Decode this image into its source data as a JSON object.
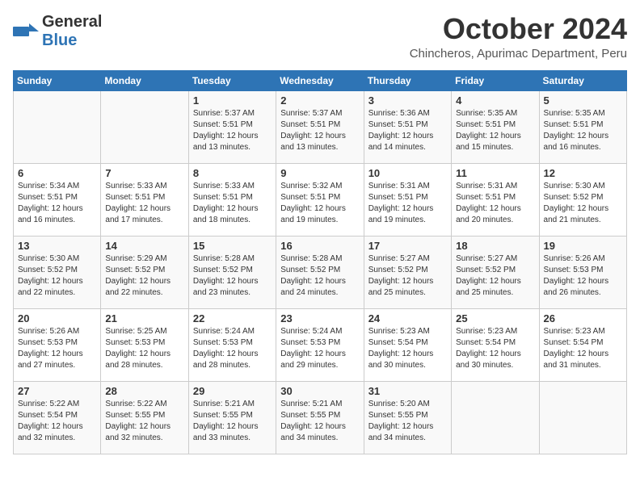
{
  "logo": {
    "general": "General",
    "blue": "Blue"
  },
  "title": "October 2024",
  "subtitle": "Chincheros, Apurimac Department, Peru",
  "days_header": [
    "Sunday",
    "Monday",
    "Tuesday",
    "Wednesday",
    "Thursday",
    "Friday",
    "Saturday"
  ],
  "weeks": [
    [
      {
        "day": "",
        "sunrise": "",
        "sunset": "",
        "daylight": ""
      },
      {
        "day": "",
        "sunrise": "",
        "sunset": "",
        "daylight": ""
      },
      {
        "day": "1",
        "sunrise": "Sunrise: 5:37 AM",
        "sunset": "Sunset: 5:51 PM",
        "daylight": "Daylight: 12 hours and 13 minutes."
      },
      {
        "day": "2",
        "sunrise": "Sunrise: 5:37 AM",
        "sunset": "Sunset: 5:51 PM",
        "daylight": "Daylight: 12 hours and 13 minutes."
      },
      {
        "day": "3",
        "sunrise": "Sunrise: 5:36 AM",
        "sunset": "Sunset: 5:51 PM",
        "daylight": "Daylight: 12 hours and 14 minutes."
      },
      {
        "day": "4",
        "sunrise": "Sunrise: 5:35 AM",
        "sunset": "Sunset: 5:51 PM",
        "daylight": "Daylight: 12 hours and 15 minutes."
      },
      {
        "day": "5",
        "sunrise": "Sunrise: 5:35 AM",
        "sunset": "Sunset: 5:51 PM",
        "daylight": "Daylight: 12 hours and 16 minutes."
      }
    ],
    [
      {
        "day": "6",
        "sunrise": "Sunrise: 5:34 AM",
        "sunset": "Sunset: 5:51 PM",
        "daylight": "Daylight: 12 hours and 16 minutes."
      },
      {
        "day": "7",
        "sunrise": "Sunrise: 5:33 AM",
        "sunset": "Sunset: 5:51 PM",
        "daylight": "Daylight: 12 hours and 17 minutes."
      },
      {
        "day": "8",
        "sunrise": "Sunrise: 5:33 AM",
        "sunset": "Sunset: 5:51 PM",
        "daylight": "Daylight: 12 hours and 18 minutes."
      },
      {
        "day": "9",
        "sunrise": "Sunrise: 5:32 AM",
        "sunset": "Sunset: 5:51 PM",
        "daylight": "Daylight: 12 hours and 19 minutes."
      },
      {
        "day": "10",
        "sunrise": "Sunrise: 5:31 AM",
        "sunset": "Sunset: 5:51 PM",
        "daylight": "Daylight: 12 hours and 19 minutes."
      },
      {
        "day": "11",
        "sunrise": "Sunrise: 5:31 AM",
        "sunset": "Sunset: 5:51 PM",
        "daylight": "Daylight: 12 hours and 20 minutes."
      },
      {
        "day": "12",
        "sunrise": "Sunrise: 5:30 AM",
        "sunset": "Sunset: 5:52 PM",
        "daylight": "Daylight: 12 hours and 21 minutes."
      }
    ],
    [
      {
        "day": "13",
        "sunrise": "Sunrise: 5:30 AM",
        "sunset": "Sunset: 5:52 PM",
        "daylight": "Daylight: 12 hours and 22 minutes."
      },
      {
        "day": "14",
        "sunrise": "Sunrise: 5:29 AM",
        "sunset": "Sunset: 5:52 PM",
        "daylight": "Daylight: 12 hours and 22 minutes."
      },
      {
        "day": "15",
        "sunrise": "Sunrise: 5:28 AM",
        "sunset": "Sunset: 5:52 PM",
        "daylight": "Daylight: 12 hours and 23 minutes."
      },
      {
        "day": "16",
        "sunrise": "Sunrise: 5:28 AM",
        "sunset": "Sunset: 5:52 PM",
        "daylight": "Daylight: 12 hours and 24 minutes."
      },
      {
        "day": "17",
        "sunrise": "Sunrise: 5:27 AM",
        "sunset": "Sunset: 5:52 PM",
        "daylight": "Daylight: 12 hours and 25 minutes."
      },
      {
        "day": "18",
        "sunrise": "Sunrise: 5:27 AM",
        "sunset": "Sunset: 5:52 PM",
        "daylight": "Daylight: 12 hours and 25 minutes."
      },
      {
        "day": "19",
        "sunrise": "Sunrise: 5:26 AM",
        "sunset": "Sunset: 5:53 PM",
        "daylight": "Daylight: 12 hours and 26 minutes."
      }
    ],
    [
      {
        "day": "20",
        "sunrise": "Sunrise: 5:26 AM",
        "sunset": "Sunset: 5:53 PM",
        "daylight": "Daylight: 12 hours and 27 minutes."
      },
      {
        "day": "21",
        "sunrise": "Sunrise: 5:25 AM",
        "sunset": "Sunset: 5:53 PM",
        "daylight": "Daylight: 12 hours and 28 minutes."
      },
      {
        "day": "22",
        "sunrise": "Sunrise: 5:24 AM",
        "sunset": "Sunset: 5:53 PM",
        "daylight": "Daylight: 12 hours and 28 minutes."
      },
      {
        "day": "23",
        "sunrise": "Sunrise: 5:24 AM",
        "sunset": "Sunset: 5:53 PM",
        "daylight": "Daylight: 12 hours and 29 minutes."
      },
      {
        "day": "24",
        "sunrise": "Sunrise: 5:23 AM",
        "sunset": "Sunset: 5:54 PM",
        "daylight": "Daylight: 12 hours and 30 minutes."
      },
      {
        "day": "25",
        "sunrise": "Sunrise: 5:23 AM",
        "sunset": "Sunset: 5:54 PM",
        "daylight": "Daylight: 12 hours and 30 minutes."
      },
      {
        "day": "26",
        "sunrise": "Sunrise: 5:23 AM",
        "sunset": "Sunset: 5:54 PM",
        "daylight": "Daylight: 12 hours and 31 minutes."
      }
    ],
    [
      {
        "day": "27",
        "sunrise": "Sunrise: 5:22 AM",
        "sunset": "Sunset: 5:54 PM",
        "daylight": "Daylight: 12 hours and 32 minutes."
      },
      {
        "day": "28",
        "sunrise": "Sunrise: 5:22 AM",
        "sunset": "Sunset: 5:55 PM",
        "daylight": "Daylight: 12 hours and 32 minutes."
      },
      {
        "day": "29",
        "sunrise": "Sunrise: 5:21 AM",
        "sunset": "Sunset: 5:55 PM",
        "daylight": "Daylight: 12 hours and 33 minutes."
      },
      {
        "day": "30",
        "sunrise": "Sunrise: 5:21 AM",
        "sunset": "Sunset: 5:55 PM",
        "daylight": "Daylight: 12 hours and 34 minutes."
      },
      {
        "day": "31",
        "sunrise": "Sunrise: 5:20 AM",
        "sunset": "Sunset: 5:55 PM",
        "daylight": "Daylight: 12 hours and 34 minutes."
      },
      {
        "day": "",
        "sunrise": "",
        "sunset": "",
        "daylight": ""
      },
      {
        "day": "",
        "sunrise": "",
        "sunset": "",
        "daylight": ""
      }
    ]
  ]
}
